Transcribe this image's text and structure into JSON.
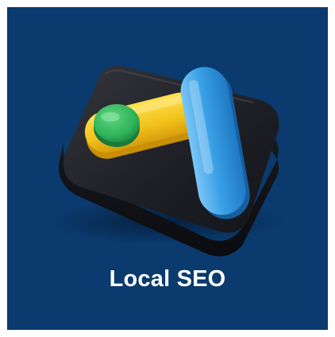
{
  "card": {
    "title": "Local SEO",
    "icon": "google-ads-logo-3d-icon",
    "colors": {
      "background": "#0a3a6e",
      "tile": "#1b1c22",
      "yellow": "#f2c21b",
      "blue": "#3aa0e6",
      "green": "#2fb35a"
    }
  }
}
